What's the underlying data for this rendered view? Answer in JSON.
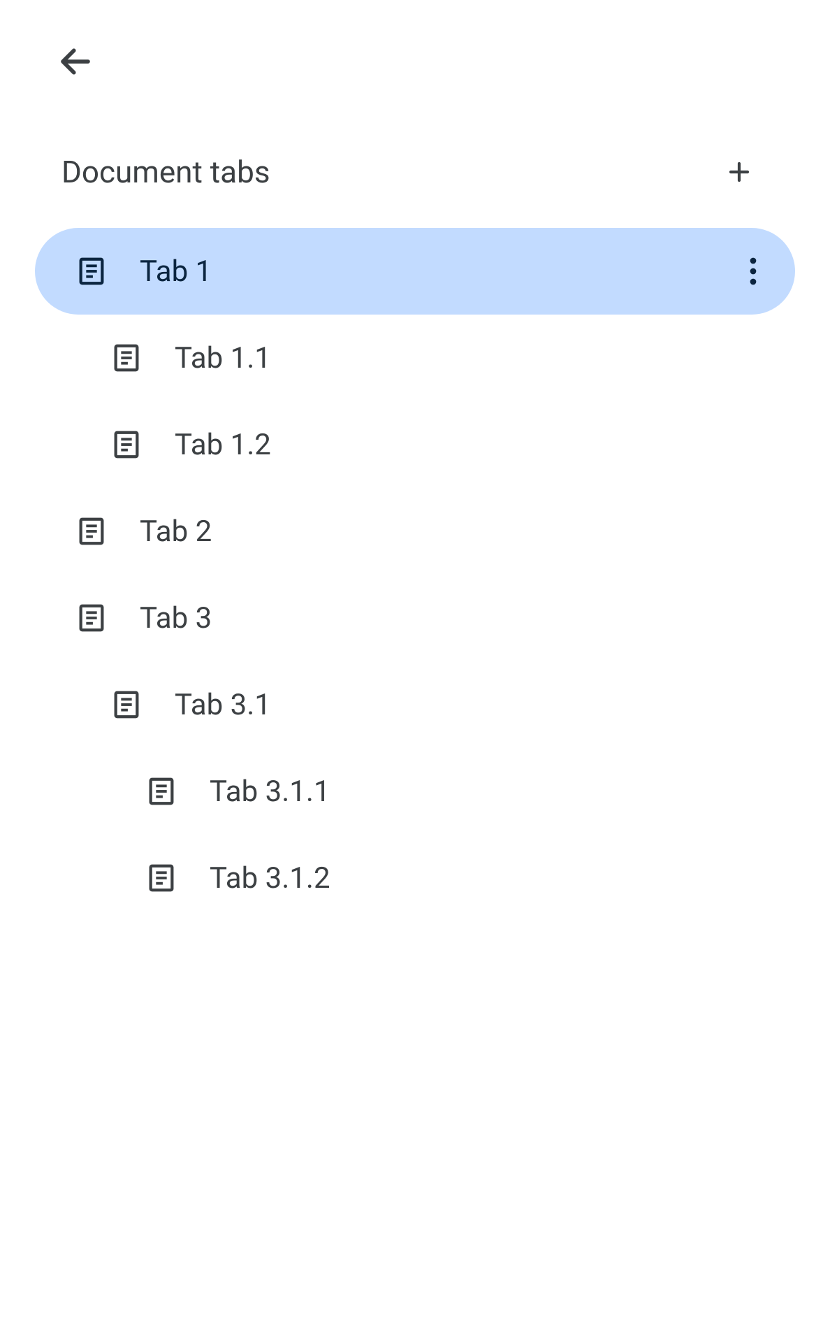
{
  "header": {
    "title": "Document tabs"
  },
  "tabs": [
    {
      "label": "Tab 1",
      "indent": 0,
      "selected": true
    },
    {
      "label": "Tab 1.1",
      "indent": 1,
      "selected": false
    },
    {
      "label": "Tab 1.2",
      "indent": 1,
      "selected": false
    },
    {
      "label": "Tab 2",
      "indent": 0,
      "selected": false
    },
    {
      "label": "Tab 3",
      "indent": 0,
      "selected": false
    },
    {
      "label": "Tab 3.1",
      "indent": 1,
      "selected": false
    },
    {
      "label": "Tab 3.1.1",
      "indent": 2,
      "selected": false
    },
    {
      "label": "Tab 3.1.2",
      "indent": 2,
      "selected": false
    }
  ],
  "colors": {
    "selected_bg": "#c2dbff",
    "text": "#3c4043",
    "selected_text": "#0b2540"
  }
}
